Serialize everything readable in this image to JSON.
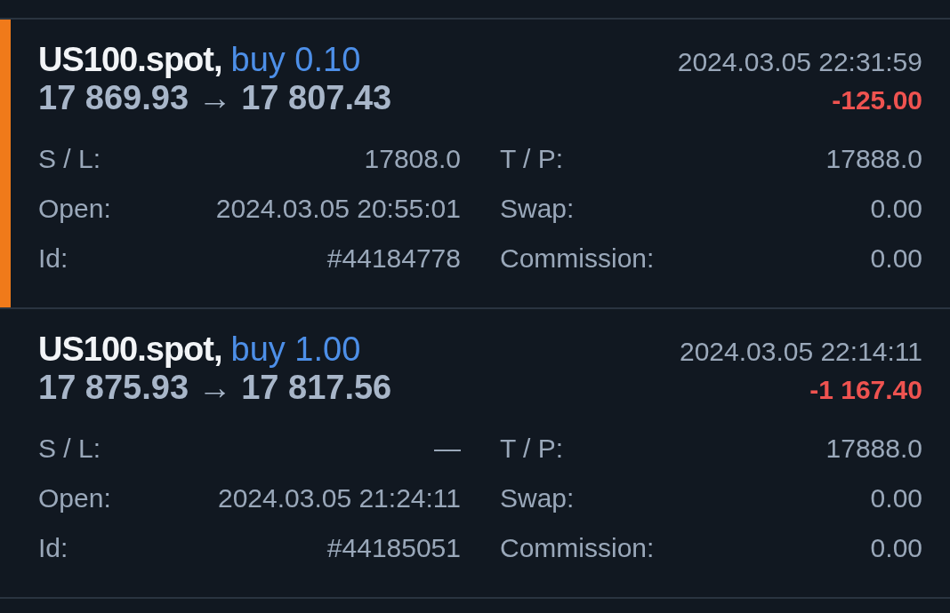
{
  "positions": [
    {
      "symbol": "US100.spot,",
      "side": "buy 0.10",
      "time": "2024.03.05 22:31:59",
      "prices": "17 869.93 → 17 807.43",
      "profit": "-125.00",
      "selected": true,
      "details": [
        {
          "label": "S / L:",
          "value": "17808.0"
        },
        {
          "label": "T / P:",
          "value": "17888.0"
        },
        {
          "label": "Open:",
          "value": "2024.03.05 20:55:01"
        },
        {
          "label": "Swap:",
          "value": "0.00"
        },
        {
          "label": "Id:",
          "value": "#44184778"
        },
        {
          "label": "Commission:",
          "value": "0.00"
        }
      ]
    },
    {
      "symbol": "US100.spot,",
      "side": "buy 1.00",
      "time": "2024.03.05 22:14:11",
      "prices": "17 875.93 → 17 817.56",
      "profit": "-1 167.40",
      "selected": false,
      "details": [
        {
          "label": "S / L:",
          "value": "—"
        },
        {
          "label": "T / P:",
          "value": "17888.0"
        },
        {
          "label": "Open:",
          "value": "2024.03.05 21:24:11"
        },
        {
          "label": "Swap:",
          "value": "0.00"
        },
        {
          "label": "Id:",
          "value": "#44185051"
        },
        {
          "label": "Commission:",
          "value": "0.00"
        }
      ]
    }
  ]
}
